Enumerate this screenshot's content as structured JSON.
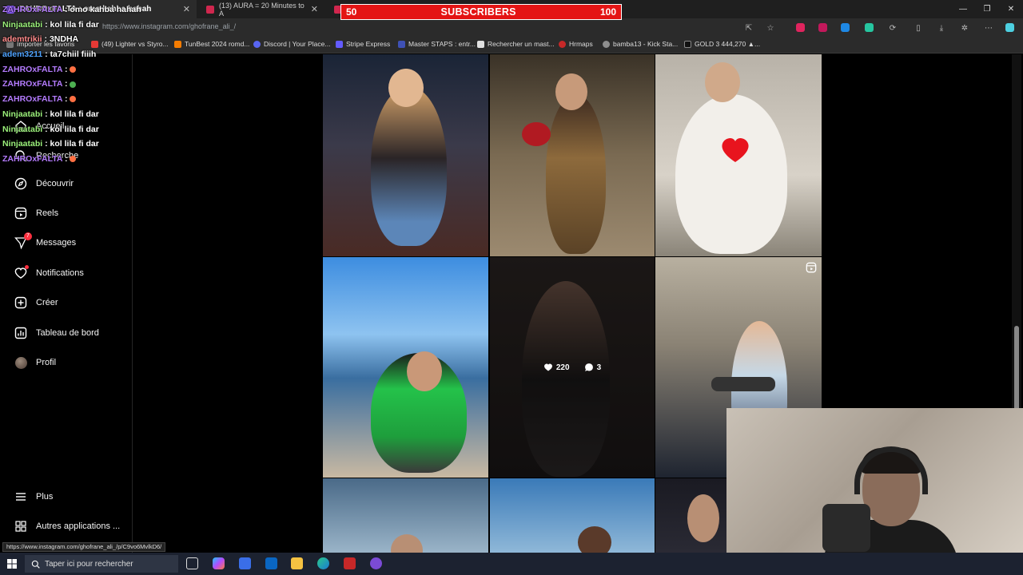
{
  "browser": {
    "tabs": [
      {
        "label": "ZAHROxFALTA : omo kahba hahah"
      },
      {
        "label": "(13) AURA = 20 Minutes to A"
      },
      {
        "label": ""
      }
    ],
    "url": "https://www.instagram.com/ghofrane_ali_/",
    "bookmarks": [
      "Importer les favoris",
      "(49) Lighter vs Styro...",
      "TunBest 2024 romd...",
      "Discord | Your Place...",
      "Stripe Express",
      "Master STAPS : entr...",
      "Rechercher un mast...",
      "Hrmaps",
      "bamba13 - Kick Sta...",
      "GOLD 3 444,270 ▲..."
    ]
  },
  "sub_goal": {
    "current": "50",
    "label": "SUBSCRIBERS",
    "target": "100"
  },
  "chat": [
    {
      "user": "ZAHROxFALTA",
      "msg": "omo kahba hahah",
      "color": "#b57cff"
    },
    {
      "user": "Ninjaatabi",
      "msg": "kol lila fi dar",
      "color": "#9bf07a"
    },
    {
      "user": "ademtrikii",
      "msg": "3NDHA",
      "color": "#ff8a8a"
    },
    {
      "user": "adem3211",
      "msg": "ta7chiil fiiih",
      "color": "#4fa3ff"
    },
    {
      "user": "ZAHROxFALTA",
      "msg": "",
      "color": "#b57cff"
    },
    {
      "user": "ZAHROxFALTA",
      "msg": "",
      "color": "#b57cff"
    },
    {
      "user": "ZAHROxFALTA",
      "msg": "",
      "color": "#b57cff"
    },
    {
      "user": "Ninjaatabi",
      "msg": "kol lila fi dar",
      "color": "#9bf07a"
    },
    {
      "user": "Ninjaatabi",
      "msg": "kol lila fi dar",
      "color": "#9bf07a"
    },
    {
      "user": "Ninjaatabi",
      "msg": "kol lila fi dar",
      "color": "#9bf07a"
    },
    {
      "user": "ZAHROxFALTA",
      "msg": "",
      "color": "#b57cff"
    }
  ],
  "sidebar": {
    "items": [
      {
        "label": "Accueil",
        "icon": "home-icon"
      },
      {
        "label": "Recherche",
        "icon": "search-icon"
      },
      {
        "label": "Découvrir",
        "icon": "compass-icon"
      },
      {
        "label": "Reels",
        "icon": "reels-icon"
      },
      {
        "label": "Messages",
        "icon": "messenger-icon",
        "badge": "7"
      },
      {
        "label": "Notifications",
        "icon": "heart-icon"
      },
      {
        "label": "Créer",
        "icon": "plus-square-icon"
      },
      {
        "label": "Tableau de bord",
        "icon": "chart-icon"
      },
      {
        "label": "Profil",
        "icon": "avatar"
      }
    ],
    "bottom": [
      {
        "label": "Plus",
        "icon": "menu-icon"
      },
      {
        "label": "Autres applications ...",
        "icon": "apps-grid-icon"
      }
    ]
  },
  "hovered_post": {
    "likes": "220",
    "comments": "3"
  },
  "status_url": "https://www.instagram.com/ghofrane_ali_/p/C9vo6MvlkD6/",
  "taskbar": {
    "search_placeholder": "Taper ici pour rechercher"
  }
}
